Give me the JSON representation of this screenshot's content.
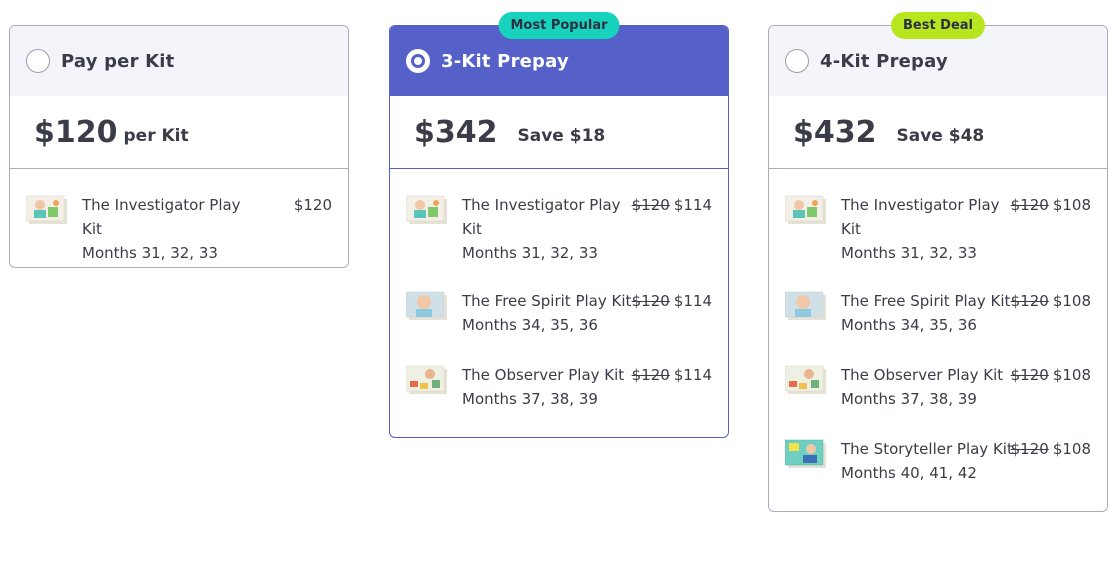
{
  "plans": [
    {
      "title": "Pay per Kit",
      "ribbon": "",
      "selected": false,
      "price": "$120",
      "price_sub": "per Kit",
      "kits": [
        {
          "name": "The Investigator Play Kit",
          "months": "Months 31, 32, 33",
          "old_price": "",
          "price": "$120",
          "thumb": "thumb-green"
        }
      ]
    },
    {
      "title": "3-Kit Prepay",
      "ribbon": "Most Popular",
      "ribbon_color": "#17d3bd",
      "selected": true,
      "price": "$342",
      "price_sub": "Save $18",
      "kits": [
        {
          "name": "The Investigator Play Kit",
          "months": "Months 31, 32, 33",
          "old_price": "$120",
          "price": "$114"
        },
        {
          "name": "The Free Spirit Play Kit",
          "months": "Months 34, 35, 36",
          "old_price": "$120",
          "price": "$114"
        },
        {
          "name": "The Observer Play Kit",
          "months": "Months 37, 38, 39",
          "old_price": "$120",
          "price": "$114"
        }
      ]
    },
    {
      "title": "4-Kit Prepay",
      "ribbon": "Best Deal",
      "ribbon_color": "#b8e61e",
      "selected": false,
      "price": "$432",
      "price_sub": "Save $48",
      "kits": [
        {
          "name": "The Investigator Play Kit",
          "months": "Months 31, 32, 33",
          "old_price": "$120",
          "price": "$108"
        },
        {
          "name": "The Free Spirit Play Kit",
          "months": "Months 34, 35, 36",
          "old_price": "$120",
          "price": "$108"
        },
        {
          "name": "The Observer Play Kit",
          "months": "Months 37, 38, 39",
          "old_price": "$120",
          "price": "$108"
        },
        {
          "name": "The Storyteller Play Kit",
          "months": "Months 40, 41, 42",
          "old_price": "$120",
          "price": "$108"
        }
      ]
    }
  ],
  "colors": {
    "accent": "#5561c8",
    "header_bg": "#f4f5fb",
    "border": "#a9adb8",
    "text": "#3a3d48"
  }
}
